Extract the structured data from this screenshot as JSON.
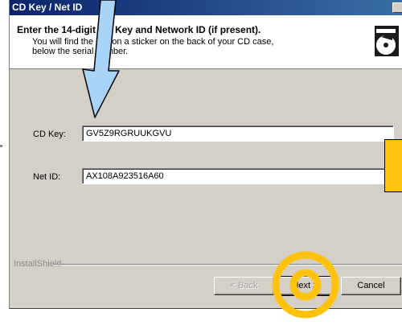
{
  "window": {
    "title": "CD Key / Net ID"
  },
  "header": {
    "title": "Enter the 14-digit CD Key and Network ID (if present).",
    "subtitle": "You will find the key on a sticker on the back of your CD case, below the serial number."
  },
  "form": {
    "cd_key": {
      "label": "CD Key:",
      "value": "GV5Z9RGRUUKGVU"
    },
    "net_id": {
      "label": "Net ID:",
      "value": "AX108A923516A60"
    }
  },
  "footer": {
    "brand": "InstallShield",
    "back_label": "< Back",
    "next_label": "Next >",
    "cancel_label": "Cancel"
  },
  "annotations": {
    "arrow_color": "#a8d4f8",
    "highlight_color": "#ffc20e"
  }
}
